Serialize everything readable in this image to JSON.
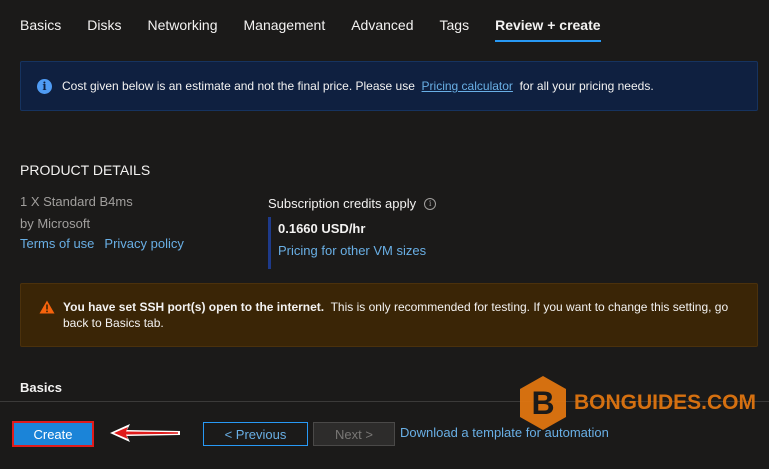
{
  "tabs": [
    {
      "label": "Basics",
      "active": false
    },
    {
      "label": "Disks",
      "active": false
    },
    {
      "label": "Networking",
      "active": false
    },
    {
      "label": "Management",
      "active": false
    },
    {
      "label": "Advanced",
      "active": false
    },
    {
      "label": "Tags",
      "active": false
    },
    {
      "label": "Review + create",
      "active": true
    }
  ],
  "info_banner": {
    "icon": "info-icon",
    "text_before": "Cost given below is an estimate and not the final price. Please use",
    "link": "Pricing calculator",
    "text_after": "for all your pricing needs."
  },
  "product": {
    "section_title": "PRODUCT DETAILS",
    "name": "1 X Standard B4ms",
    "publisher": "by Microsoft",
    "terms_link": "Terms of use",
    "privacy_link": "Privacy policy"
  },
  "subscription": {
    "label": "Subscription credits apply",
    "price": "0.1660 USD/hr",
    "other_sizes_link": "Pricing for other VM sizes"
  },
  "warning_banner": {
    "icon": "warning-icon",
    "bold_text": "You have set SSH port(s) open to the internet.",
    "text": "This is only recommended for testing.  If you want to change this setting, go back to Basics tab.",
    "color": "#f7630c"
  },
  "basics_section_title": "Basics",
  "footer": {
    "create_label": "Create",
    "previous_label": "< Previous",
    "next_label": "Next >",
    "download_link": "Download a template for automation"
  },
  "watermark": {
    "text": "BONGUIDES.COM",
    "letter": "B"
  },
  "colors": {
    "accent": "#2899f5",
    "link": "#69afe5",
    "primary_button": "#1b84d8",
    "highlight_border": "#e01b1b",
    "watermark_orange": "#e07510"
  }
}
